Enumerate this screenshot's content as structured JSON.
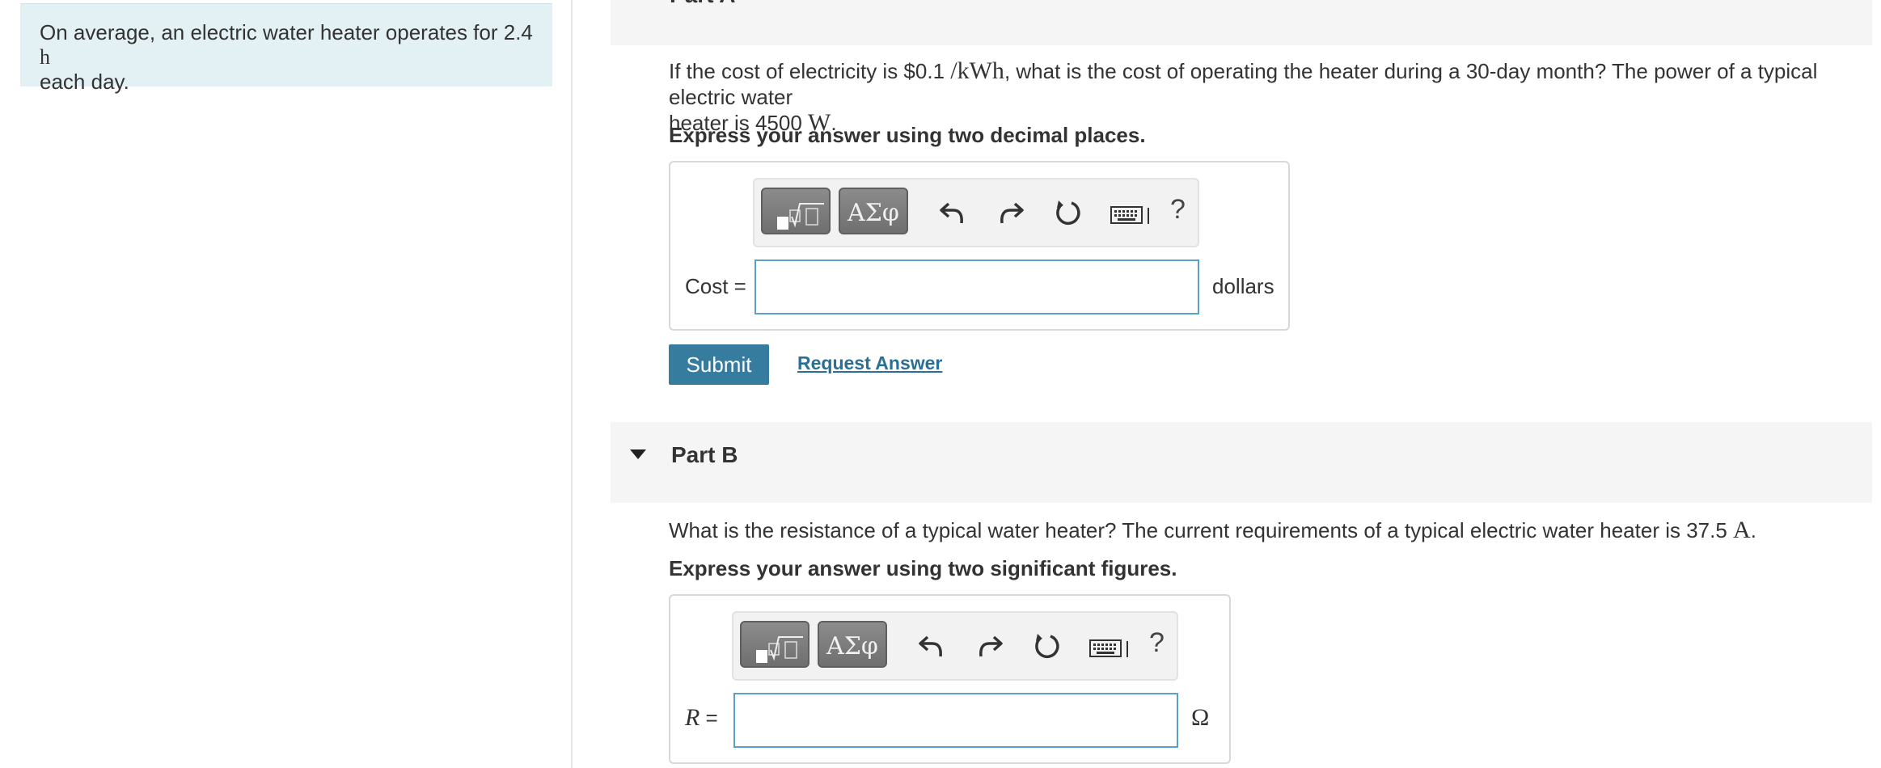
{
  "context": {
    "text_line1": "On average, an electric water heater operates for 2.4",
    "text_unit": "h",
    "text_line2": "each day."
  },
  "partA": {
    "title": "Part A",
    "question": {
      "seg1": "If the cost of electricity is $0.1",
      "seg2": "/kWh",
      "seg3": ", what is the cost of operating the heater during a 30-day month? The power of a typical electric water",
      "seg4": "heater is 4500",
      "seg5": "W",
      "seg6": "."
    },
    "express": "Express your answer using two decimal places.",
    "toolbar": {
      "templates_label": "√",
      "greek_label": "ΑΣφ",
      "help_label": "?"
    },
    "field_label": "Cost =",
    "input_value": "",
    "unit": "dollars"
  },
  "actions": {
    "submit_label": "Submit",
    "request_label": "Request Answer"
  },
  "partB": {
    "title": "Part B",
    "question": {
      "seg1": "What is the resistance of a typical water heater? The current requirements of a typical electric water heater is 37.5",
      "seg2": "A",
      "seg3": "."
    },
    "express": "Express your answer using two significant figures.",
    "toolbar": {
      "templates_label": "√",
      "greek_label": "ΑΣφ",
      "help_label": "?"
    },
    "field_label_var": "R",
    "field_label_eq": " =",
    "input_value": "",
    "unit": "Ω"
  },
  "colors": {
    "context_bg": "#e4f1f4",
    "accent": "#357c9e",
    "link": "#2a6f96",
    "input_border": "#5aa0c8"
  },
  "icons": [
    "templates-icon",
    "undo-icon",
    "redo-icon",
    "reset-icon",
    "keyboard-icon",
    "help-icon",
    "collapse-caret-icon"
  ]
}
